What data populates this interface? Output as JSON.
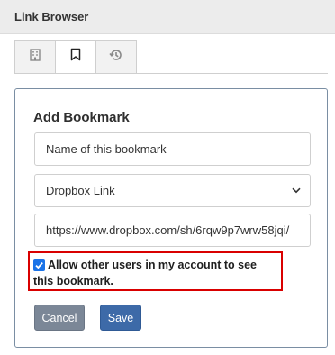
{
  "header": {
    "title": "Link Browser"
  },
  "tabs": [
    {
      "icon": "building-icon",
      "active": false
    },
    {
      "icon": "bookmark-icon",
      "active": true
    },
    {
      "icon": "history-icon",
      "active": false
    }
  ],
  "form": {
    "title": "Add Bookmark",
    "name_field": {
      "value": "",
      "placeholder": "Name of this bookmark"
    },
    "link_type": {
      "selected": "Dropbox Link"
    },
    "url_field": {
      "value": "https://www.dropbox.com/sh/6rqw9p7wrw58jqi/"
    },
    "allow_checkbox": {
      "checked": true,
      "label": "Allow other users in my account to see this bookmark."
    },
    "cancel_label": "Cancel",
    "save_label": "Save"
  },
  "colors": {
    "highlight_border": "#d90000",
    "save_button": "#3d6aa8",
    "cancel_button": "#7b8797",
    "checkbox": "#1a73e8"
  }
}
